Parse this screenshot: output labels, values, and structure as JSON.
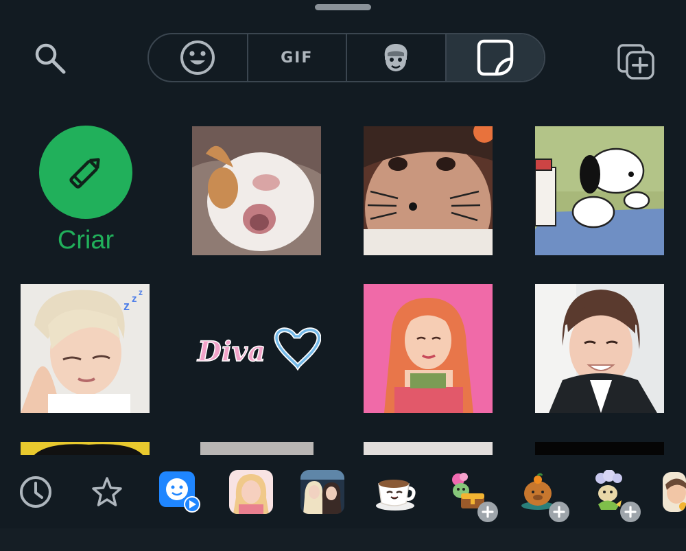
{
  "header": {
    "search_icon": "search-icon",
    "tabs": [
      {
        "name": "emoji",
        "icon": "smiley-icon"
      },
      {
        "name": "gif",
        "label": "GIF"
      },
      {
        "name": "avatar",
        "icon": "avatar-icon"
      },
      {
        "name": "stickers",
        "icon": "sticker-icon",
        "active": true
      }
    ],
    "add_pack_icon": "add-sticker-pack-icon"
  },
  "create": {
    "label": "Criar",
    "icon": "pencil-icon"
  },
  "stickers": [
    {
      "name": "sticker-cat-screaming"
    },
    {
      "name": "sticker-cat-face-filter"
    },
    {
      "name": "sticker-snoopy"
    },
    {
      "name": "sticker-sleepy-boy"
    },
    {
      "name": "sticker-diva",
      "text": "Diva"
    },
    {
      "name": "sticker-redhair-girl"
    },
    {
      "name": "sticker-smiling-boy"
    }
  ],
  "bottom_bar": [
    {
      "name": "recent-icon"
    },
    {
      "name": "favorites-star-icon"
    },
    {
      "name": "avatar-sticker-pack-icon"
    },
    {
      "name": "pack-blonde-girl"
    },
    {
      "name": "pack-two-girls"
    },
    {
      "name": "pack-coffee-cup"
    },
    {
      "name": "pack-treasure-chest",
      "downloadable": true
    },
    {
      "name": "pack-capybara",
      "downloadable": true
    },
    {
      "name": "pack-sprout-character",
      "downloadable": true
    },
    {
      "name": "pack-photo-partial"
    }
  ],
  "colors": {
    "background": "#121b22",
    "accent": "#21b05b",
    "tab_border": "#3b4650",
    "active_tab": "#28343d"
  }
}
